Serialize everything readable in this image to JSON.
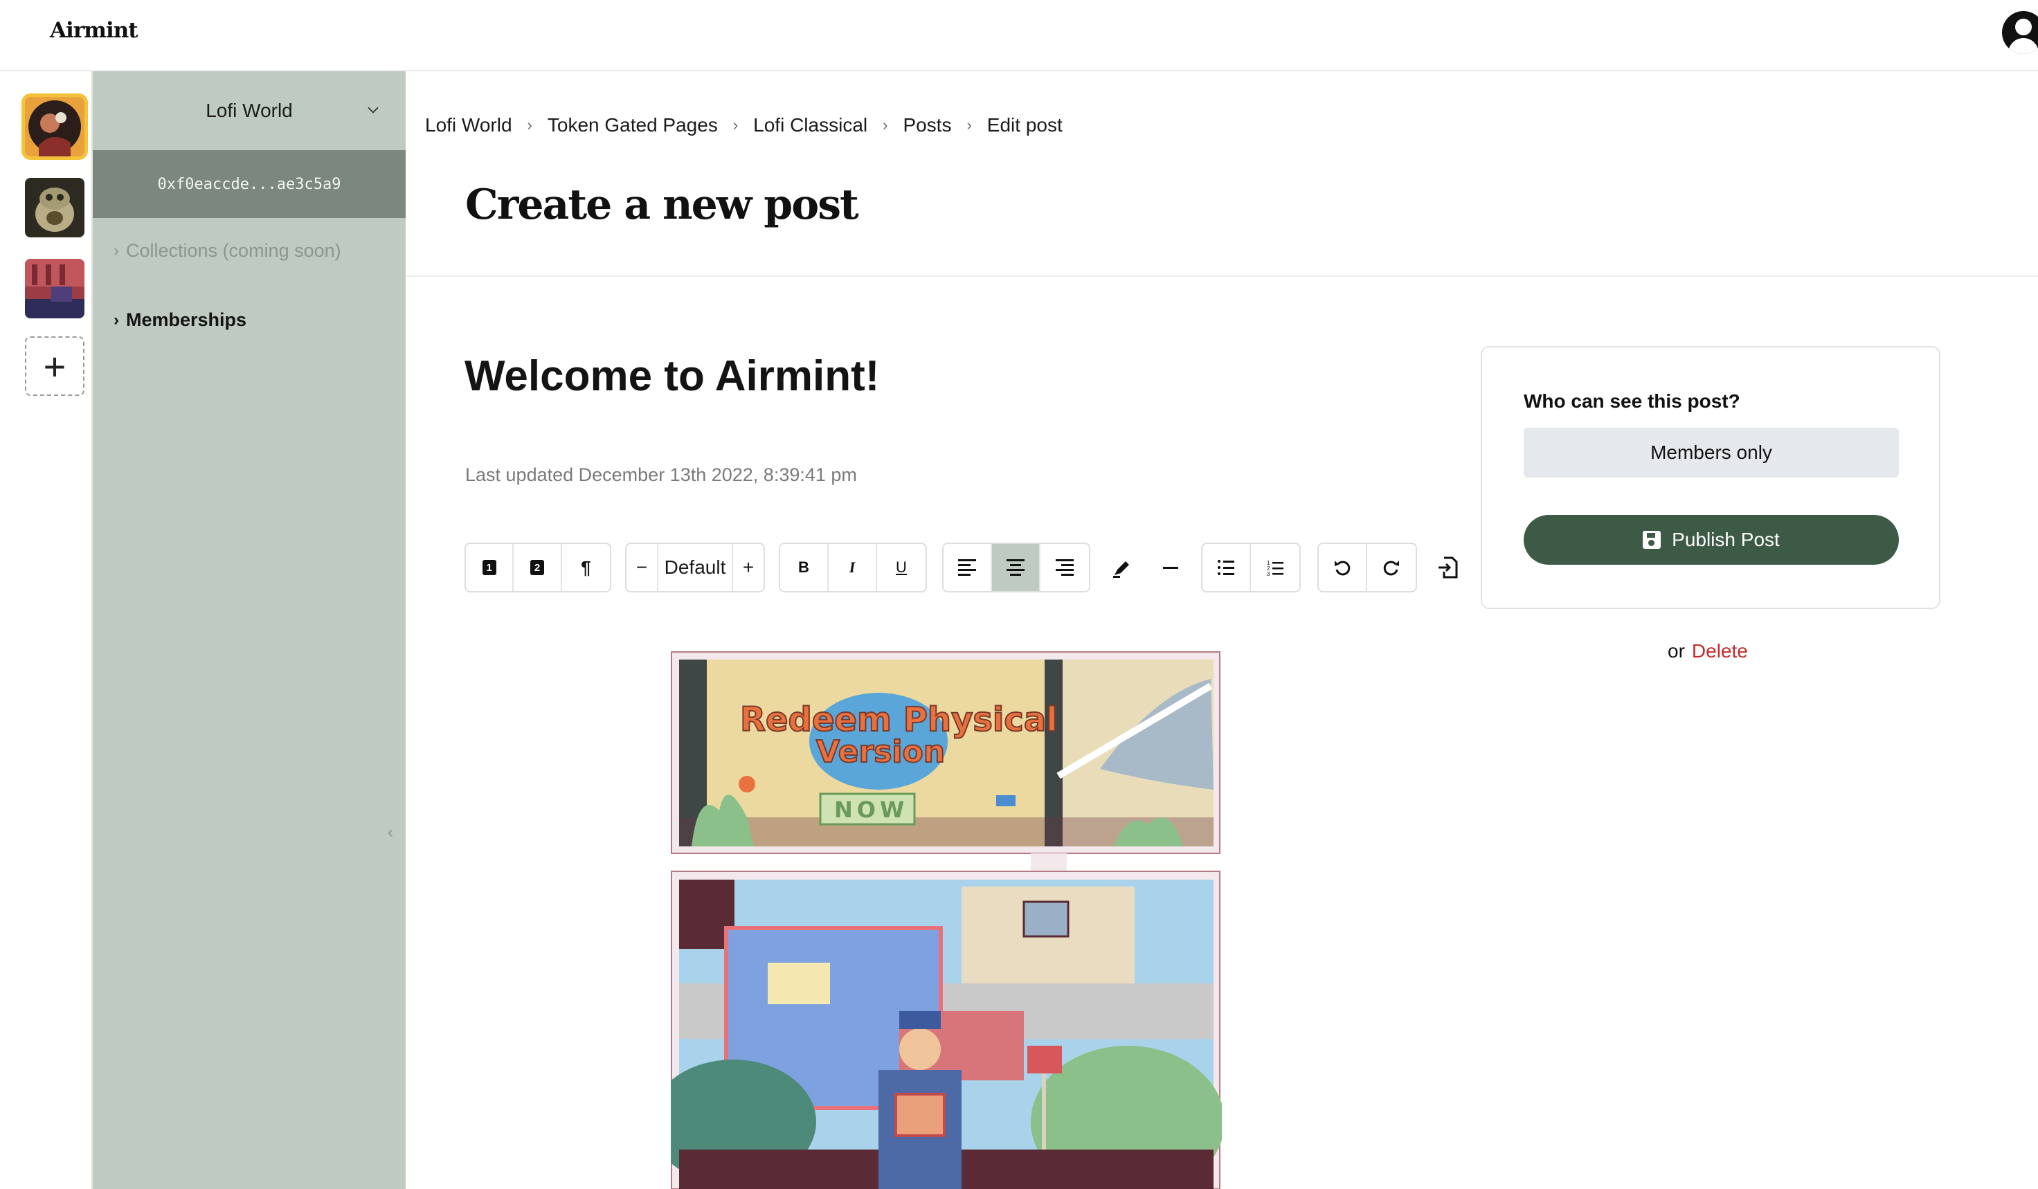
{
  "app": {
    "logo": "Airmint"
  },
  "rail": {
    "items": [
      {
        "name": "lofi-world-community",
        "active": true
      },
      {
        "name": "owl-community",
        "active": false
      },
      {
        "name": "pixel-room-community",
        "active": false
      }
    ],
    "add_label": "+"
  },
  "sidebar": {
    "title": "Lofi World",
    "wallet": "0xf0eaccde...ae3c5a9",
    "links": [
      {
        "label": "Collections (coming soon)",
        "disabled": true
      },
      {
        "label": "Memberships",
        "disabled": false
      }
    ]
  },
  "breadcrumb": [
    "Lofi World",
    "Token Gated Pages",
    "Lofi Classical",
    "Posts",
    "Edit post"
  ],
  "page": {
    "title": "Create a new post"
  },
  "post": {
    "title": "Welcome to Airmint!",
    "last_updated": "Last updated December 13th 2022, 8:39:41 pm"
  },
  "toolbar": {
    "heading1": "1",
    "heading2": "2",
    "paragraph": "¶",
    "font_size_minus": "−",
    "font_size": "Default",
    "font_size_plus": "+",
    "bold": "B",
    "italic": "I",
    "underline": "U",
    "active_alignment": "center"
  },
  "visibility": {
    "title": "Who can see this post?",
    "selected": "Members only",
    "publish_label": "Publish Post",
    "or_label": "or",
    "delete_label": "Delete"
  },
  "artwork": {
    "panel1_text": [
      "Redeem Physical",
      "Version",
      "NOW"
    ]
  },
  "colors": {
    "sidebar_bg": "#bfcac0",
    "wallet_bg": "#7c877d",
    "publish_bg": "#3c5a46",
    "delete": "#c42c2c",
    "active_rail": "#f5c33b"
  }
}
